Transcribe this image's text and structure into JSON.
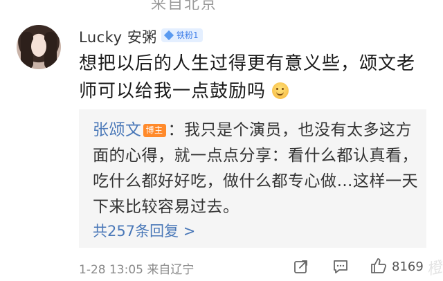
{
  "top_partial": "来自北京",
  "comment": {
    "username": "Lucky 安粥",
    "fan_badge": "铁粉1",
    "text": "想把以后的人生过得更有意义些，颂文老师可以给我一点鼓励吗",
    "emoji": "smile-emoji"
  },
  "reply": {
    "author": "张颂文",
    "author_badge": "博主",
    "text": "：我只是个演员，也没有太多这方面的心得，就一点点分享：看什么都认真看，吃什么都好好吃，做什么都专心做…这样一天下来比较容易过去。",
    "count_label": "共257条回复 >"
  },
  "meta": {
    "time": "1-28 13:05",
    "source": "来自辽宁",
    "like_count": "8169"
  },
  "icons": [
    "share-icon",
    "comment-icon",
    "like-icon"
  ],
  "colors": {
    "link": "#4a78b8",
    "badge_blue": "#3f7ee8",
    "badge_orange": "#ff8a2b"
  }
}
